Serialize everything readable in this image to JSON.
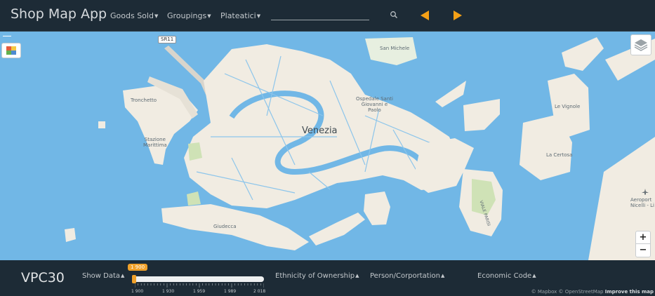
{
  "app": {
    "title": "Shop Map App"
  },
  "nav": {
    "goods_sold": "Goods Sold",
    "groupings": "Groupings",
    "plateatici": "Plateatici",
    "search_placeholder": ""
  },
  "map": {
    "city": "Venezia",
    "road_shield": "SR11",
    "labels": {
      "san_michele": "San Michele",
      "tronchetto": "Tronchetto",
      "stazione": "Stazione\nMarittima",
      "ospedale": "Ospedale Santi\nGiovanni e\nPaolo",
      "le_vignole": "Le Vignole",
      "la_certosa": "La Certosa",
      "giudecca": "Giudecca",
      "viale_parisi": "VIALE PARISI",
      "aeroporto": "Aeroport\nNicelli - Li"
    },
    "zoom_in": "+",
    "zoom_out": "−"
  },
  "bottom": {
    "layer_title": "VPC30",
    "show_data": "Show Data",
    "ethnicity": "Ethnicity of Ownership",
    "person": "Person/Corportation",
    "economic": "Economic Code",
    "slider": {
      "current": "1 900",
      "value": 1900,
      "min": 1900,
      "max": 2018,
      "tick_labels": [
        "1 900",
        "1 930",
        "1 959",
        "1 989",
        "2 018"
      ]
    },
    "attribution_prefix": "© Mapbox © OpenStreetMap",
    "attribution_link": "Improve this map"
  },
  "colors": {
    "nav_bg": "#1d2b36",
    "water": "#71b7e6",
    "land": "#f1ece2",
    "accent": "#f0a12a"
  }
}
